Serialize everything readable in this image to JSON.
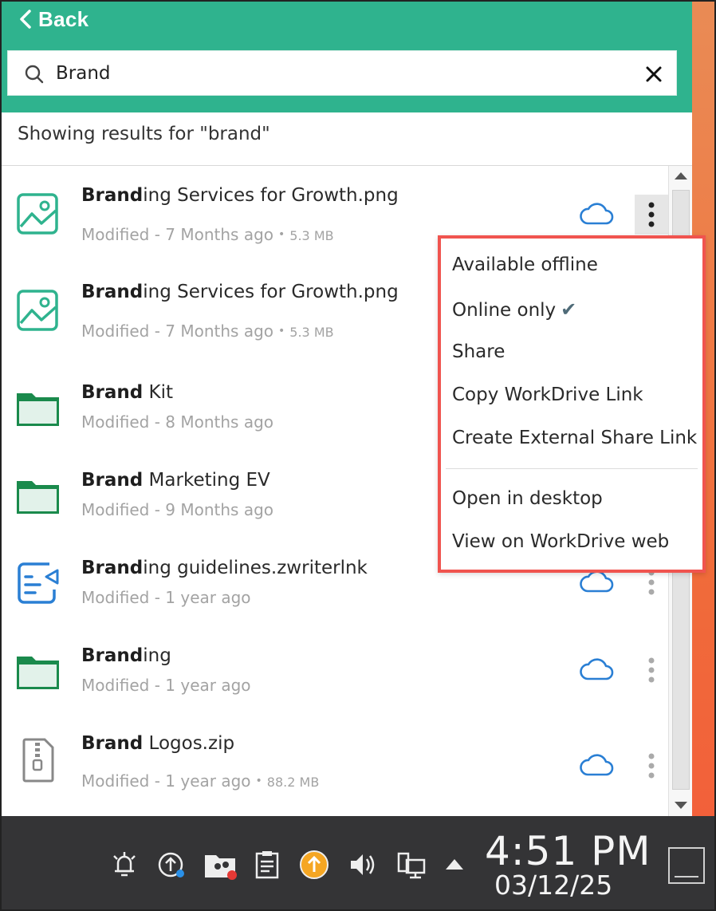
{
  "header": {
    "back_label": "Back",
    "search_value": "Brand",
    "accent_color": "#2fb38e"
  },
  "results_text": "Showing results for \"brand\"",
  "items": [
    {
      "name_bold": "Brand",
      "name_rest": "ing Services for Growth.png",
      "modified": "Modified - 7 Months ago",
      "size": "5.3 MB",
      "icon": "image-file-icon"
    },
    {
      "name_bold": "Brand",
      "name_rest": "ing Services for Growth.png",
      "modified": "Modified - 7 Months ago",
      "size": "5.3 MB",
      "icon": "image-file-icon"
    },
    {
      "name_bold": "Brand",
      "name_rest": " Kit",
      "modified": "Modified - 8 Months ago",
      "icon": "folder-icon"
    },
    {
      "name_bold": "Brand",
      "name_rest": " Marketing EV",
      "modified": "Modified - 9 Months ago",
      "icon": "folder-icon"
    },
    {
      "name_bold": "Brand",
      "name_rest": "ing guidelines.zwriterlnk",
      "modified": "Modified - 1 year ago",
      "icon": "writer-link-icon"
    },
    {
      "name_bold": "Brand",
      "name_rest": "ing",
      "modified": "Modified - 1 year ago",
      "icon": "folder-icon"
    },
    {
      "name_bold": "Brand",
      "name_rest": " Logos.zip",
      "modified": "Modified - 1 year ago",
      "size": "88.2 MB",
      "icon": "zip-file-icon"
    }
  ],
  "menu": {
    "available_offline": "Available offline",
    "online_only": "Online only",
    "online_only_check": "✔",
    "share": "Share",
    "copy_link": "Copy WorkDrive Link",
    "external_link": "Create External Share Link",
    "open_desktop": "Open in desktop",
    "view_web": "View on WorkDrive web",
    "highlight_color": "#f0544f"
  },
  "taskbar": {
    "time": "4:51 PM",
    "date": "03/12/25",
    "icons": [
      "alarm-icon",
      "sync-upload-icon",
      "folder-people-icon",
      "clipboard-icon",
      "update-icon",
      "volume-icon",
      "network-icon",
      "tray-expand-icon",
      "show-desktop-icon"
    ]
  }
}
